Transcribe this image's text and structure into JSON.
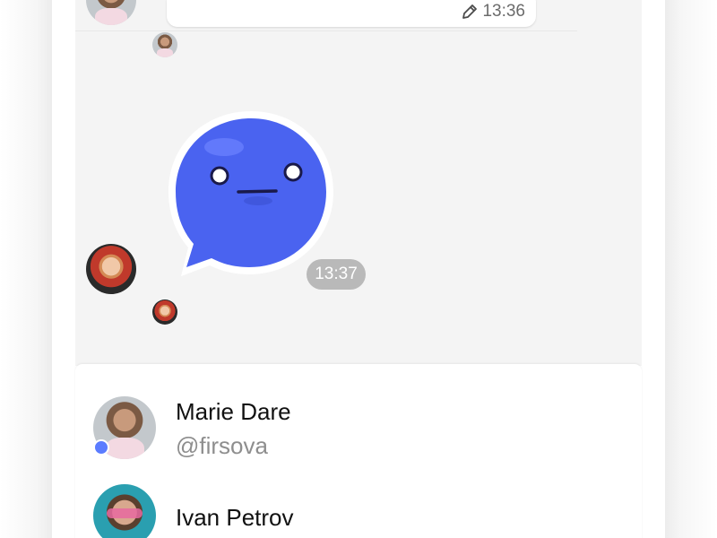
{
  "colors": {
    "chat_background": "#f4f4f4",
    "sticker_blue": "#4a63f0",
    "online_dot": "#5b7cff",
    "time_pill": "#b9b9b9"
  },
  "message": {
    "edited_icon": "pencil-icon",
    "time": "13:36"
  },
  "sticker": {
    "name": "blue-speech-bubble-face",
    "time": "13:37"
  },
  "user_list": [
    {
      "name": "Marie Dare",
      "handle": "@firsova",
      "online": true,
      "avatar": "marie-avatar"
    },
    {
      "name": "Ivan Petrov",
      "handle": "",
      "online": false,
      "avatar": "ivan-avatar"
    }
  ]
}
